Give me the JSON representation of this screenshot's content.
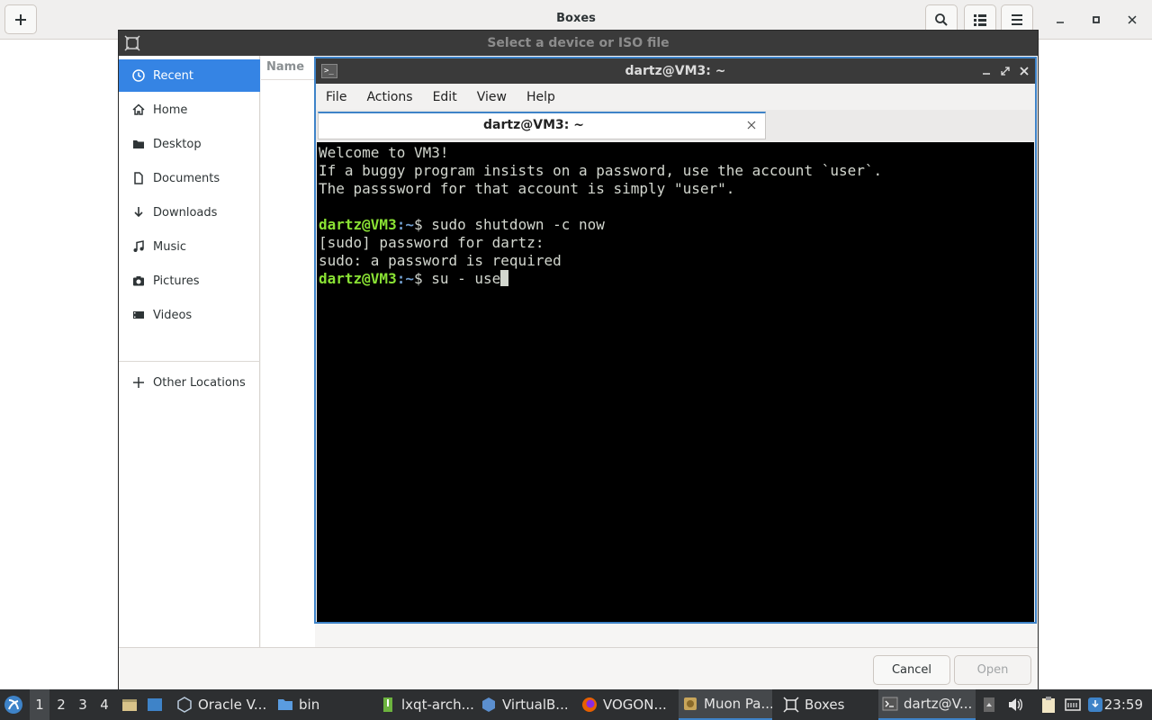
{
  "boxes": {
    "title": "Boxes"
  },
  "dialog": {
    "title": "Select a device or ISO file",
    "sidebar": [
      {
        "label": "Recent",
        "icon": "clock-icon",
        "active": true
      },
      {
        "label": "Home",
        "icon": "home-icon"
      },
      {
        "label": "Desktop",
        "icon": "folder-icon"
      },
      {
        "label": "Documents",
        "icon": "document-icon"
      },
      {
        "label": "Downloads",
        "icon": "download-icon"
      },
      {
        "label": "Music",
        "icon": "music-icon"
      },
      {
        "label": "Pictures",
        "icon": "camera-icon"
      },
      {
        "label": "Videos",
        "icon": "video-icon"
      },
      {
        "label": "Other Locations",
        "icon": "plus-icon"
      }
    ],
    "column_name": "Name",
    "cancel_label": "Cancel",
    "open_label": "Open"
  },
  "terminal": {
    "title": "dartz@VM3: ~",
    "menu": [
      "File",
      "Actions",
      "Edit",
      "View",
      "Help"
    ],
    "tab_label": "dartz@VM3: ~",
    "lines": {
      "l1": "Welcome to VM3!",
      "l2": "If a buggy program insists on a password, use the account `user`.",
      "l3": "The passsword for that account is simply \"user\".",
      "prompt_user": "dartz@VM3",
      "prompt_path": ":~",
      "cmd1": "$ sudo shutdown -c now",
      "l5": "[sudo] password for dartz:",
      "l6": "sudo: a password is required",
      "cmd2": "$ su - use"
    }
  },
  "taskbar": {
    "workspaces": [
      "1",
      "2",
      "3",
      "4"
    ],
    "tasks": [
      {
        "label": "Oracle V...",
        "icon": "virtualbox-icon"
      },
      {
        "label": "bin",
        "icon": "folder-icon"
      },
      {
        "label": "lxqt-arch...",
        "icon": "archive-icon"
      },
      {
        "label": "VirtualB...",
        "icon": "virtualbox-icon"
      },
      {
        "label": "VOGON...",
        "icon": "firefox-icon"
      },
      {
        "label": "Muon Pa...",
        "icon": "package-icon"
      },
      {
        "label": "Boxes",
        "icon": "boxes-icon"
      },
      {
        "label": "dartz@V...",
        "icon": "terminal-icon"
      }
    ],
    "clock": "23:59"
  }
}
